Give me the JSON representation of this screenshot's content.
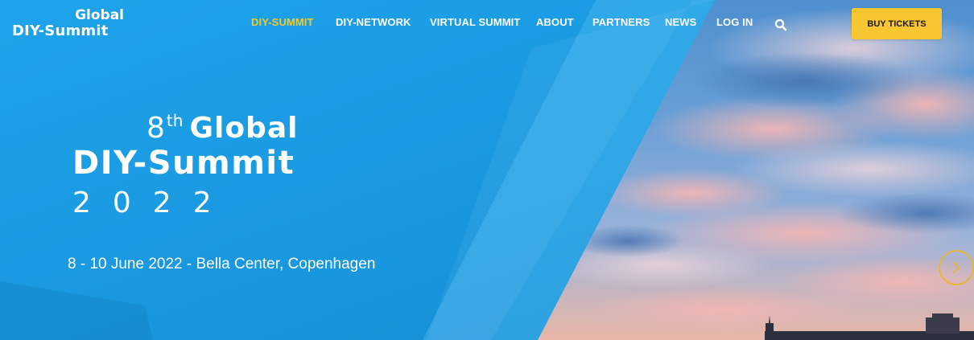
{
  "header": {
    "logo": {
      "line1": "Global",
      "line2": "DIY-Summit"
    },
    "nav": [
      {
        "label": "DIY-SUMMIT",
        "active": true
      },
      {
        "label": "DIY-NETWORK",
        "active": false
      },
      {
        "label": "VIRTUAL SUMMIT",
        "active": false
      },
      {
        "label": "ABOUT",
        "active": false
      },
      {
        "label": "PARTNERS",
        "active": false
      },
      {
        "label": "NEWS",
        "active": false
      },
      {
        "label": "LOG IN",
        "active": false
      }
    ],
    "search_icon": "search-icon",
    "buy_button": "BUY TICKETS"
  },
  "hero": {
    "ordinal": "8",
    "ordinal_suffix": "th",
    "title_word": "Global",
    "title_line2": "DIY-Summit",
    "year": "2022",
    "event_info": "8 - 10 June 2022 - Bella Center, Copenhagen",
    "next_icon": "chevron-right-icon"
  },
  "colors": {
    "brand_blue": "#1a9ee6",
    "accent_yellow": "#f8c630",
    "active_nav": "#f5c92a"
  }
}
